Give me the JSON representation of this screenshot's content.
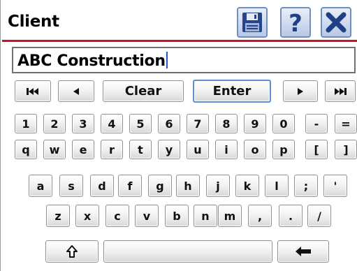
{
  "window": {
    "title": "Client"
  },
  "toolbar": {
    "save_icon": "floppy-disk-icon",
    "help_icon": "question-mark-icon",
    "close_icon": "x-close-icon",
    "accent": "#c8122e"
  },
  "input": {
    "value": "ABC Construction"
  },
  "nav": {
    "first_icon": "skip-to-start-icon",
    "prev_icon": "left-triangle-icon",
    "clear_label": "Clear",
    "enter_label": "Enter",
    "next_icon": "right-triangle-icon",
    "last_icon": "skip-to-end-icon"
  },
  "rows": {
    "numbers": [
      "1",
      "2",
      "3",
      "4",
      "5",
      "6",
      "7",
      "8",
      "9",
      "0",
      "-",
      "="
    ],
    "qwerty": [
      "q",
      "w",
      "e",
      "r",
      "t",
      "y",
      "u",
      "i",
      "o",
      "p",
      "[",
      "]"
    ],
    "asdf": [
      "a",
      "s",
      "d",
      "f",
      "g",
      "h",
      "j",
      "k",
      "l",
      ";",
      "'"
    ],
    "zxcv": [
      "z",
      "x",
      "c",
      "v",
      "b",
      "n",
      "m",
      ",",
      ".",
      "/"
    ]
  },
  "bottom": {
    "shift_icon": "shift-arrow-icon",
    "space_label": "",
    "backspace_icon": "backspace-arrow-icon"
  }
}
